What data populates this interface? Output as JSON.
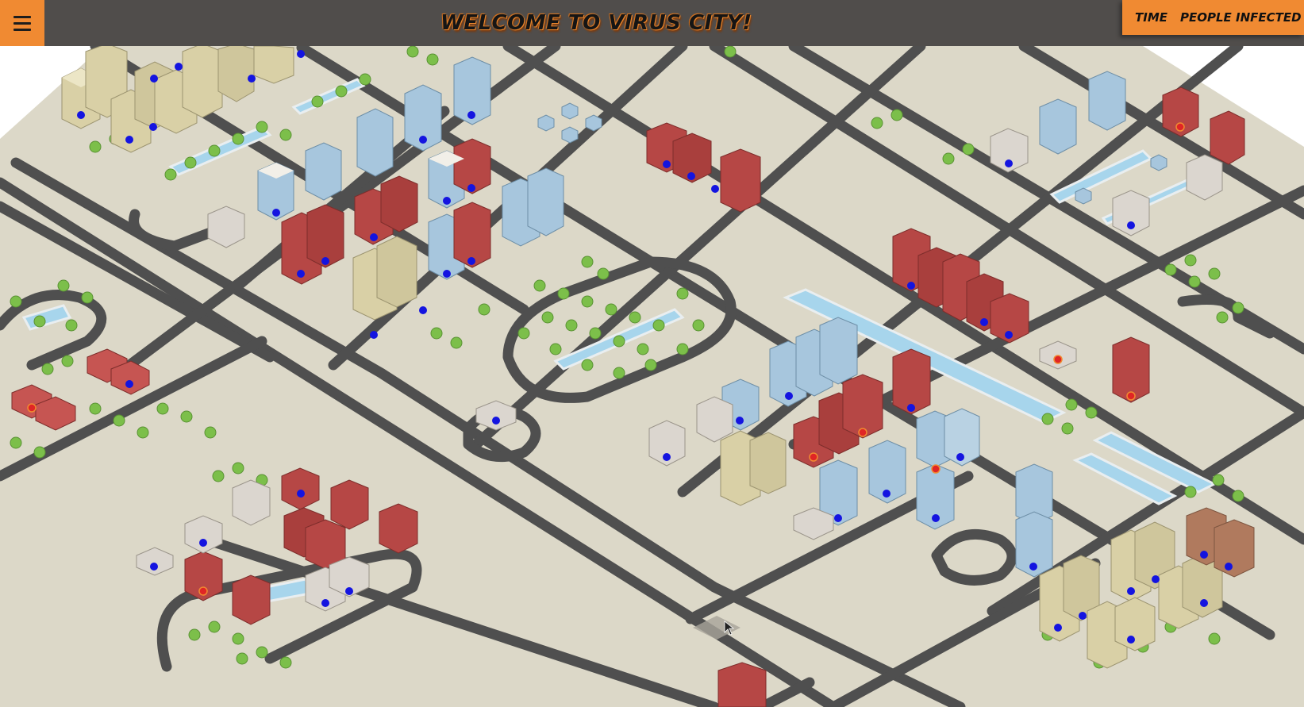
{
  "header": {
    "title": "WELCOME TO VIRUS CITY!",
    "menu_icon": "hamburger-icon",
    "stats": {
      "time_label": "TIME",
      "infected_label": "PEOPLE INFECTED"
    }
  },
  "map": {
    "colors": {
      "ground": "#dcd8c8",
      "road": "#4f4f4f",
      "water": "#a7d5ec",
      "tree": "#7cbf4a",
      "healthy_person": "#1414e0",
      "infected_person": "#e02525",
      "building_red": "#b64745",
      "building_blue": "#a7c6dd",
      "building_tan": "#d9d0a6",
      "accent": "#f08a32"
    }
  }
}
